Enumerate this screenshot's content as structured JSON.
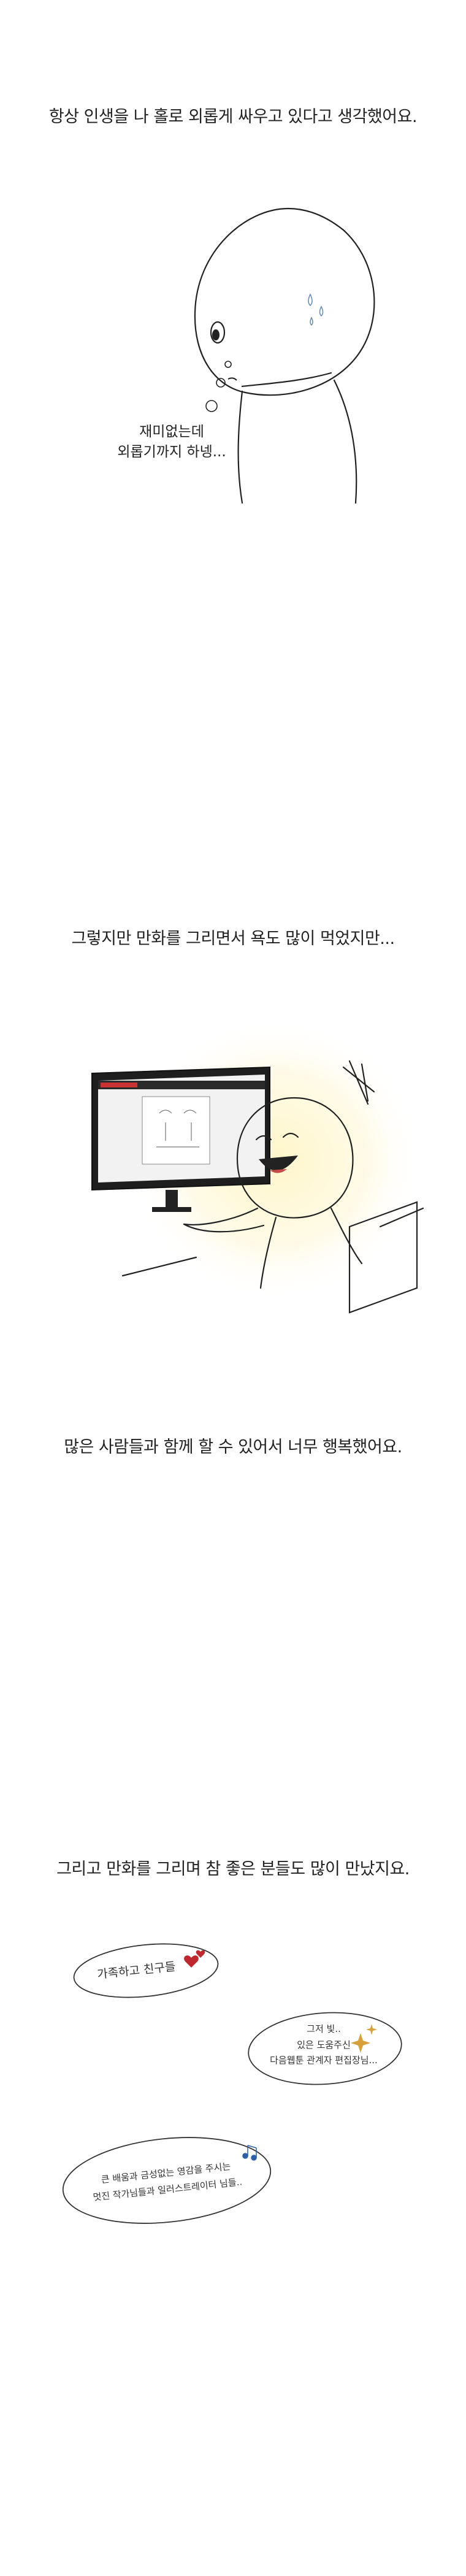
{
  "panel1": {
    "caption": "항상 인생을 나 홀로 외롭게 싸우고 있다고 생각했어요.",
    "thought_lines": [
      "재미없는데",
      "외롭기까지 하넹..."
    ]
  },
  "panel2": {
    "caption": "그렇지만 만화를 그리면서 욕도 많이 먹었지만..."
  },
  "panel3": {
    "caption": "많은 사람들과 함께 할 수 있어서 너무 행복했어요."
  },
  "panel4": {
    "caption": "그리고 만화를 그리며 참 좋은 분들도 많이 만났지요.",
    "bubble1": "가족하고 친구들",
    "bubble2_lines": [
      "그저 빛..",
      "있은 도움주신",
      "다음웹툰 관계자 편집장님..."
    ],
    "bubble3_lines": [
      "큰 배움과 금성없는 영감을 주시는",
      "멋진 작가님들과 일러스트레이터 님들.."
    ]
  },
  "colors": {
    "ink": "#222222",
    "heart": "#c0282f",
    "sparkle": "#d8a23a",
    "glow": "#fff4c4",
    "monitor_accent": "#c73333"
  }
}
